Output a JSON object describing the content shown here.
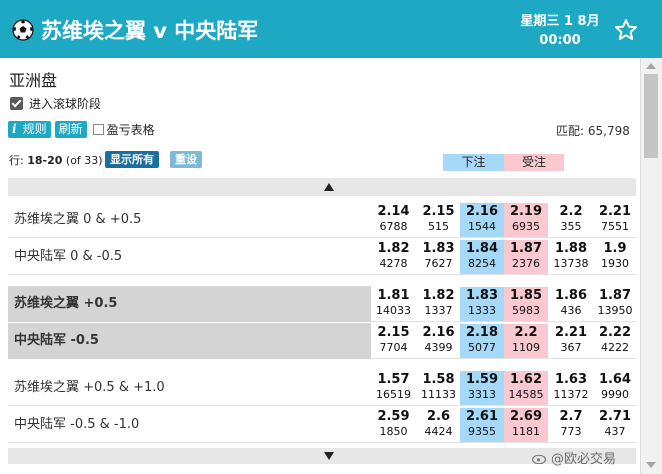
{
  "header": {
    "title": "苏维埃之翼 v 中央陆军",
    "day": "星期三 1 8月",
    "time": "00:00",
    "colors": {
      "header_bg": "#1da8c4"
    }
  },
  "market": {
    "title": "亚洲盘",
    "inplay_label": "进入滚球阶段",
    "inplay_checked": true
  },
  "toolbar": {
    "rules_icon": "i",
    "rules_label": "规则",
    "refresh_label": "刷新",
    "pnl_label": "盈亏表格",
    "matched_label": "匹配: 65,798"
  },
  "pager": {
    "rows_label": "行:",
    "rows_range": "18-20",
    "rows_total": "(of 33)",
    "show_all_label": "显示所有",
    "reset_label": "重设"
  },
  "columns": {
    "back_label": "下注",
    "lay_label": "受注"
  },
  "rows": [
    {
      "name": "苏维埃之翼 0 & +0.5",
      "prices": [
        [
          "2.14",
          "6788"
        ],
        [
          "2.15",
          "515"
        ],
        [
          "2.16",
          "1544"
        ],
        [
          "2.19",
          "6935"
        ],
        [
          "2.2",
          "355"
        ],
        [
          "2.21",
          "7551"
        ]
      ]
    },
    {
      "name": "中央陆军 0 & -0.5",
      "prices": [
        [
          "1.82",
          "4278"
        ],
        [
          "1.83",
          "7627"
        ],
        [
          "1.84",
          "8254"
        ],
        [
          "1.87",
          "2376"
        ],
        [
          "1.88",
          "13738"
        ],
        [
          "1.9",
          "1930"
        ]
      ]
    },
    {
      "name": "苏维埃之翼 +0.5",
      "prices": [
        [
          "1.81",
          "14033"
        ],
        [
          "1.82",
          "1337"
        ],
        [
          "1.83",
          "1333"
        ],
        [
          "1.85",
          "5983"
        ],
        [
          "1.86",
          "436"
        ],
        [
          "1.87",
          "13950"
        ]
      ]
    },
    {
      "name": "中央陆军 -0.5",
      "prices": [
        [
          "2.15",
          "7704"
        ],
        [
          "2.16",
          "4399"
        ],
        [
          "2.18",
          "5077"
        ],
        [
          "2.2",
          "1109"
        ],
        [
          "2.21",
          "367"
        ],
        [
          "2.22",
          "4222"
        ]
      ]
    },
    {
      "name": "苏维埃之翼 +0.5 & +1.0",
      "prices": [
        [
          "1.57",
          "16519"
        ],
        [
          "1.58",
          "11133"
        ],
        [
          "1.59",
          "3313"
        ],
        [
          "1.62",
          "14585"
        ],
        [
          "1.63",
          "11372"
        ],
        [
          "1.64",
          "9990"
        ]
      ]
    },
    {
      "name": "中央陆军 -0.5 & -1.0",
      "prices": [
        [
          "2.59",
          "1850"
        ],
        [
          "2.6",
          "4424"
        ],
        [
          "2.61",
          "9355"
        ],
        [
          "2.69",
          "1181"
        ],
        [
          "2.7",
          "773"
        ],
        [
          "2.71",
          "437"
        ]
      ]
    }
  ],
  "watermark": "@欧必交易"
}
